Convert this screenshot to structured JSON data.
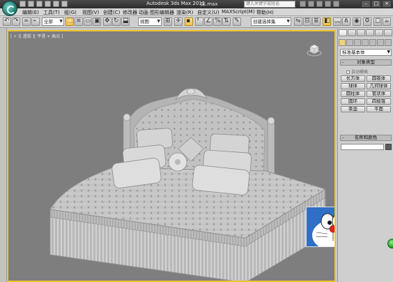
{
  "titlebar": {
    "app_title": "Autodesk 3ds Max  2011",
    "file_title": "床.max",
    "help_search_placeholder": "键入关键字或短语",
    "window_controls": [
      "–",
      "□",
      "×"
    ]
  },
  "menubar": {
    "items": [
      "编辑(E)",
      "工具(T)",
      "组(G)",
      "视图(V)",
      "创建(C)",
      "修改器",
      "动画",
      "图形编辑器",
      "渲染(R)",
      "自定义(U)",
      "MAXScript(M)",
      "帮助(H)"
    ]
  },
  "toolbar": {
    "selection_filter": "全部",
    "reference_coord": "视图",
    "named_selection": "创建选择集"
  },
  "viewport": {
    "label": "[ + ][ 透视 ][ 平滑 + 高光 ]"
  },
  "command_panel": {
    "category": "标准基本体",
    "object_type_header": "对象类型",
    "autogrid_label": "自动栅格",
    "objects": [
      "长方体",
      "圆锥体",
      "球体",
      "几何球体",
      "圆柱体",
      "管状体",
      "圆环",
      "四棱锥",
      "茶壶",
      "平面"
    ],
    "name_color_header": "名称和颜色"
  },
  "colors": {
    "viewport_bg": "#7e7e7e",
    "viewport_border": "#f2c42c",
    "panel_bg": "#cfcfcf"
  }
}
